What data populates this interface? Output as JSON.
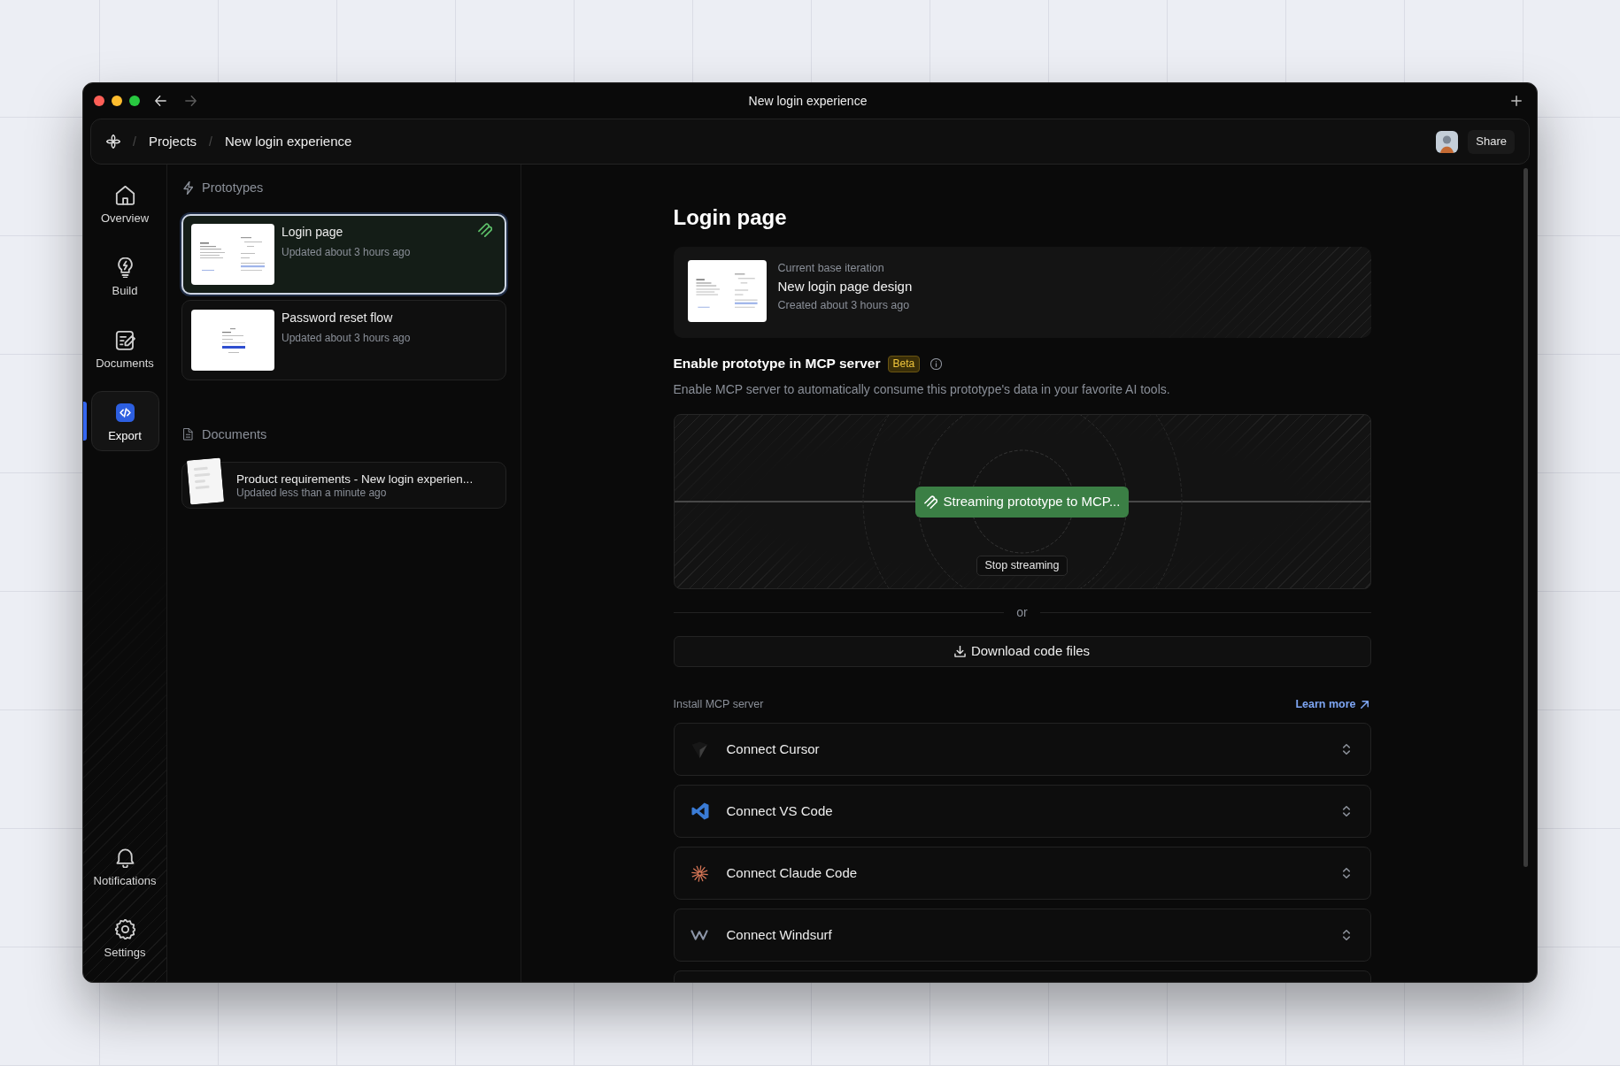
{
  "window": {
    "title": "New login experience",
    "nav_buttons": [
      {
        "kind": "back",
        "disabled": false
      },
      {
        "kind": "forward",
        "disabled": true
      }
    ]
  },
  "breadcrumb": {
    "separator": "/",
    "items": [
      "Projects",
      "New login experience"
    ]
  },
  "header_actions": {
    "share": "Share"
  },
  "nav": {
    "top_items": [
      {
        "label": "Overview",
        "selected": false
      },
      {
        "label": "Build",
        "selected": false
      },
      {
        "label": "Documents",
        "selected": false
      },
      {
        "label": "Export",
        "selected": true
      }
    ],
    "bottom_items": [
      {
        "label": "Notifications",
        "selected": false
      },
      {
        "label": "Settings",
        "selected": false
      }
    ]
  },
  "prototypes": {
    "heading": "Prototypes",
    "items": [
      {
        "title": "Login page",
        "subtitle": "Updated about 3 hours ago",
        "selected": true,
        "streaming": true
      },
      {
        "title": "Password reset flow",
        "subtitle": "Updated about 3 hours ago",
        "selected": false,
        "streaming": false
      }
    ]
  },
  "documents": {
    "heading": "Documents",
    "items": [
      {
        "title": "Product requirements - New login experien...",
        "subtitle": "Updated less than a minute ago"
      }
    ]
  },
  "detail": {
    "title": "Login page",
    "base_iteration": {
      "label": "Current base iteration",
      "name": "New login page design",
      "created": "Created about 3 hours ago"
    },
    "mcp": {
      "title": "Enable prototype in MCP server",
      "badge": "Beta",
      "description": "Enable MCP server to automatically consume this prototype's data in your favorite AI tools.",
      "streaming_button": "Streaming prototype to MCP...",
      "stop_button": "Stop streaming"
    },
    "divider_text": "or",
    "download_button": "Download code files",
    "install": {
      "heading": "Install MCP server",
      "link": "Learn more",
      "connectors": [
        {
          "label": "Connect Cursor"
        },
        {
          "label": "Connect VS Code"
        },
        {
          "label": "Connect Claude Code"
        },
        {
          "label": "Connect Windsurf"
        }
      ]
    }
  }
}
